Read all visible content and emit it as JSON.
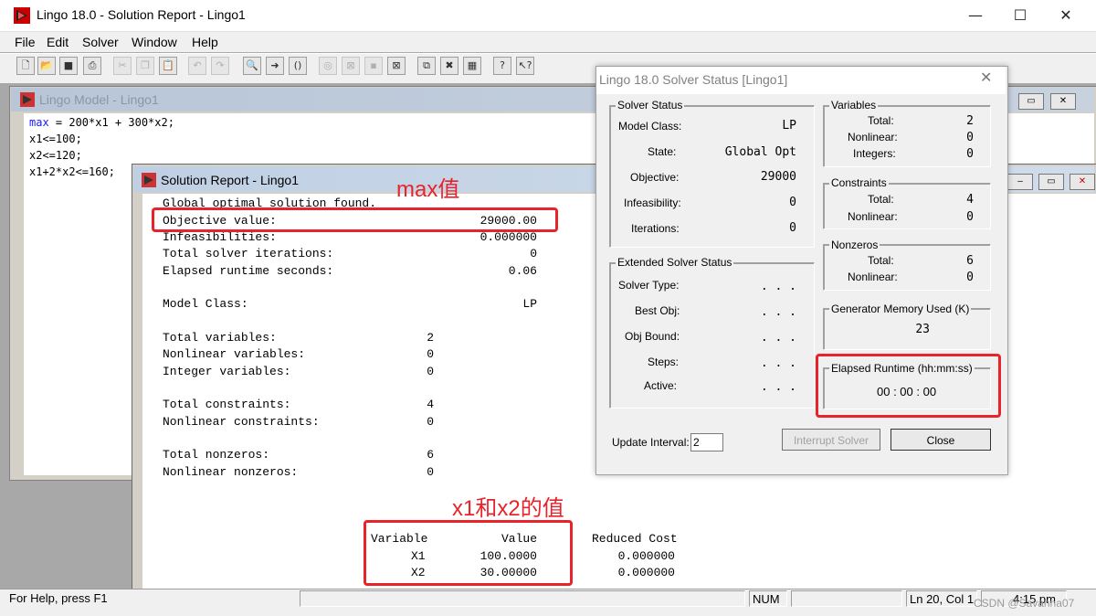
{
  "app": {
    "title": "Lingo 18.0 - Solution Report - Lingo1",
    "minimize_icon": "—",
    "maximize_icon": "☐",
    "close_icon": "✕"
  },
  "menu": [
    "File",
    "Edit",
    "Solver",
    "Window",
    "Help"
  ],
  "toolbar": [
    "new",
    "open",
    "save",
    "print",
    "cut",
    "copy",
    "paste",
    "undo",
    "redo",
    "find",
    "find-next",
    "match-paren",
    "solve",
    "stop",
    "range",
    "options",
    "tile",
    "cascade",
    "arrange",
    "help",
    "context-help"
  ],
  "model_window": {
    "title": "Lingo Model - Lingo1",
    "code": [
      {
        "kw": "max",
        "rest": " = 200*x1 + 300*x2;"
      },
      {
        "kw": "",
        "rest": "x1<=100;"
      },
      {
        "kw": "",
        "rest": "x2<=120;"
      },
      {
        "kw": "",
        "rest": "x1+2*x2<=160;"
      }
    ]
  },
  "solution_window": {
    "title": "Solution Report - Lingo1",
    "header": "Global optimal solution found.",
    "lines": [
      {
        "label": "Objective value:",
        "value": "29000.00"
      },
      {
        "label": "Infeasibilities:",
        "value": "0.000000"
      },
      {
        "label": "Total solver iterations:",
        "value": "0"
      },
      {
        "label": "Elapsed runtime seconds:",
        "value": "0.06"
      },
      {
        "label": "Model Class:",
        "value": "LP"
      },
      {
        "label": "Total variables:",
        "value": "2"
      },
      {
        "label": "Nonlinear variables:",
        "value": "0"
      },
      {
        "label": "Integer variables:",
        "value": "0"
      },
      {
        "label": "Total constraints:",
        "value": "4"
      },
      {
        "label": "Nonlinear constraints:",
        "value": "0"
      },
      {
        "label": "Total nonzeros:",
        "value": "6"
      },
      {
        "label": "Nonlinear nonzeros:",
        "value": "0"
      }
    ],
    "table": {
      "headers": [
        "Variable",
        "Value",
        "Reduced Cost"
      ],
      "rows": [
        [
          "X1",
          "100.0000",
          "0.000000"
        ],
        [
          "X2",
          "30.00000",
          "0.000000"
        ]
      ]
    }
  },
  "annotations": {
    "max_label": "max值",
    "x_label": "x1和x2的值"
  },
  "dialog": {
    "title": "Lingo 18.0 Solver Status [Lingo1]",
    "solver_status": {
      "group": "Solver Status",
      "fields": [
        {
          "label": "Model Class:",
          "value": "LP"
        },
        {
          "label": "State:",
          "value": "Global Opt"
        },
        {
          "label": "Objective:",
          "value": "29000"
        },
        {
          "label": "Infeasibility:",
          "value": "0"
        },
        {
          "label": "Iterations:",
          "value": "0"
        }
      ]
    },
    "extended": {
      "group": "Extended Solver Status",
      "fields": [
        {
          "label": "Solver Type:",
          "value": ". . ."
        },
        {
          "label": "Best Obj:",
          "value": ". . ."
        },
        {
          "label": "Obj Bound:",
          "value": ". . ."
        },
        {
          "label": "Steps:",
          "value": ". . ."
        },
        {
          "label": "Active:",
          "value": ". . ."
        }
      ]
    },
    "variables": {
      "group": "Variables",
      "fields": [
        {
          "label": "Total:",
          "value": "2"
        },
        {
          "label": "Nonlinear:",
          "value": "0"
        },
        {
          "label": "Integers:",
          "value": "0"
        }
      ]
    },
    "constraints": {
      "group": "Constraints",
      "fields": [
        {
          "label": "Total:",
          "value": "4"
        },
        {
          "label": "Nonlinear:",
          "value": "0"
        }
      ]
    },
    "nonzeros": {
      "group": "Nonzeros",
      "fields": [
        {
          "label": "Total:",
          "value": "6"
        },
        {
          "label": "Nonlinear:",
          "value": "0"
        }
      ]
    },
    "memory": {
      "group": "Generator Memory Used (K)",
      "value": "23"
    },
    "runtime": {
      "group": "Elapsed Runtime (hh:mm:ss)",
      "value": "00 : 00 : 00"
    },
    "update_interval_label": "Update Interval:",
    "update_interval_value": "2",
    "interrupt_button": "Interrupt Solver",
    "close_button": "Close"
  },
  "statusbar": {
    "help": "For Help, press F1",
    "num": "NUM",
    "position": "Ln 20, Col 1",
    "time": "4:15 pm",
    "watermark": "CSDN @Savanna07"
  },
  "colors": {
    "annotation": "#e8232a",
    "keyword": "#1a1aff"
  }
}
